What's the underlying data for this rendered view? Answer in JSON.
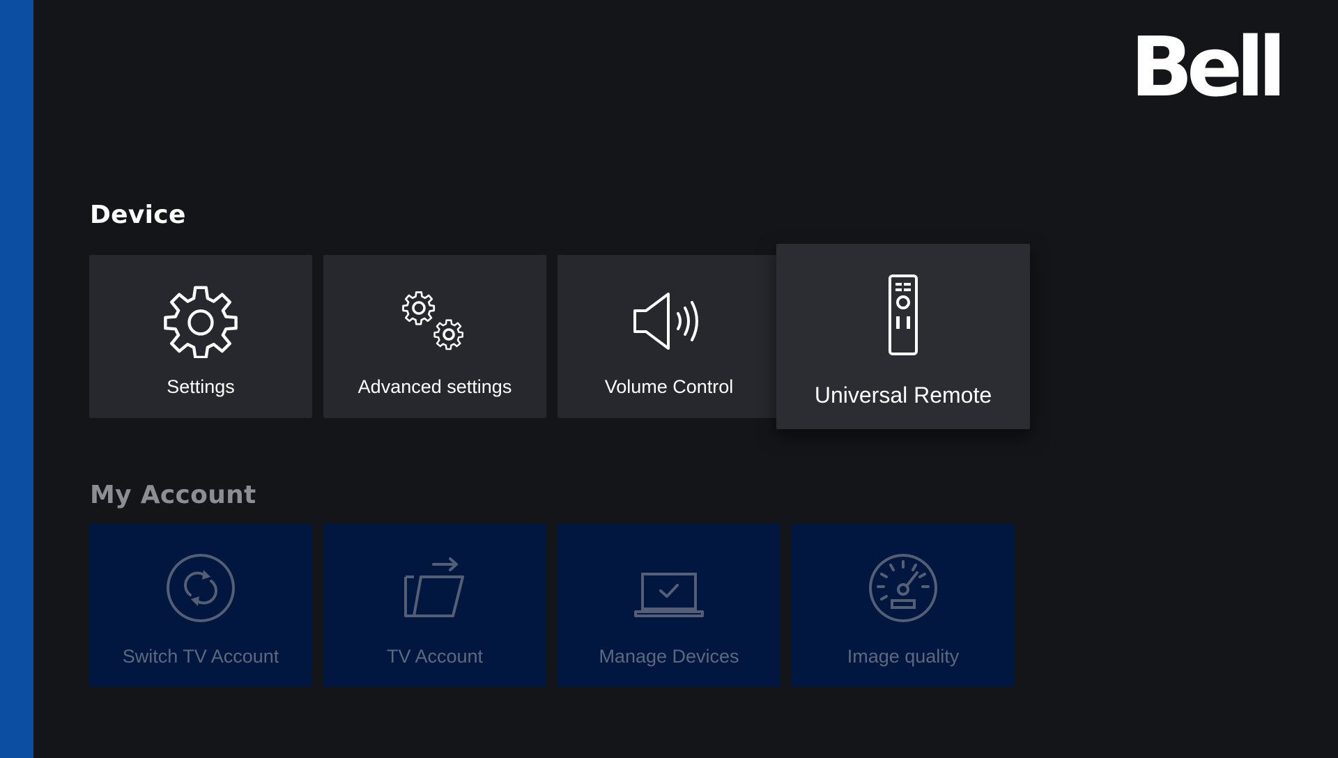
{
  "brand": {
    "logo_text": "Bell"
  },
  "device": {
    "title": "Device",
    "tiles": [
      {
        "label": "Settings",
        "icon": "gear-icon"
      },
      {
        "label": "Advanced settings",
        "icon": "gears-icon"
      },
      {
        "label": "Volume Control",
        "icon": "speaker-icon"
      },
      {
        "label": "Universal Remote",
        "icon": "remote-control-icon",
        "focused": true
      }
    ]
  },
  "account": {
    "title": "My Account",
    "tiles": [
      {
        "label": "Switch TV Account",
        "icon": "refresh-circle-icon"
      },
      {
        "label": "TV Account",
        "icon": "folder-export-icon"
      },
      {
        "label": "Manage Devices",
        "icon": "laptop-check-icon"
      },
      {
        "label": "Image quality",
        "icon": "speedometer-icon"
      }
    ]
  },
  "colors": {
    "background": "#141519",
    "side_strip": "#0b4ea2",
    "device_tile": "#27282d",
    "device_tile_focused": "#2c2d33",
    "account_tile": "#02173f",
    "account_label": "#5d6880",
    "account_title": "#8d8e93"
  }
}
